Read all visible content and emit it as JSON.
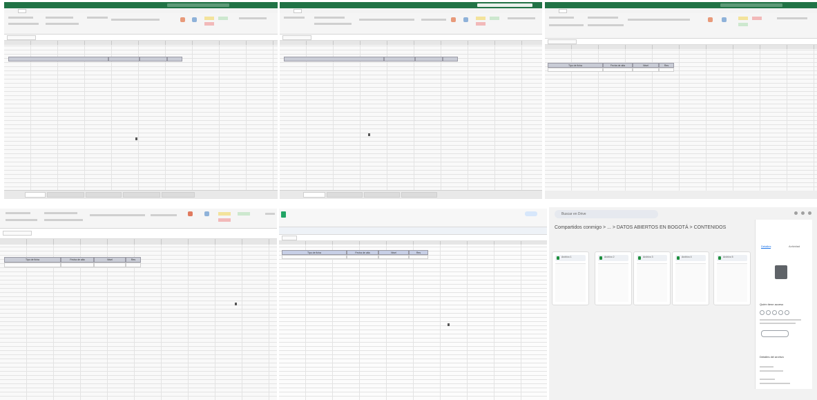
{
  "panel3": {
    "table_headers": [
      "Tipo de ficha",
      "Fecha de alta",
      "Nivel",
      "Res"
    ]
  },
  "panel4": {
    "table_headers": [
      "Tipo de ficha",
      "Fecha de alta",
      "Nivel",
      "Res"
    ]
  },
  "panel5": {
    "table_headers": [
      "Tipo de ficha",
      "Fecha de alta",
      "Nivel",
      "Res"
    ]
  },
  "panel6": {
    "search_placeholder": "Buscar en Drive",
    "breadcrumb": "Compartidos conmigo  >  ...  >  DATOS ABIERTOS EN BOGOTÁ  >  CONTENIDOS",
    "files": [
      "Archivo 1",
      "Archivo 2",
      "Archivo 3",
      "Archivo 4",
      "Archivo 5"
    ],
    "side_tabs": [
      "Detalles",
      "Actividad"
    ],
    "access_label": "Quién tiene acceso",
    "details_label": "Detalles del archivo"
  }
}
